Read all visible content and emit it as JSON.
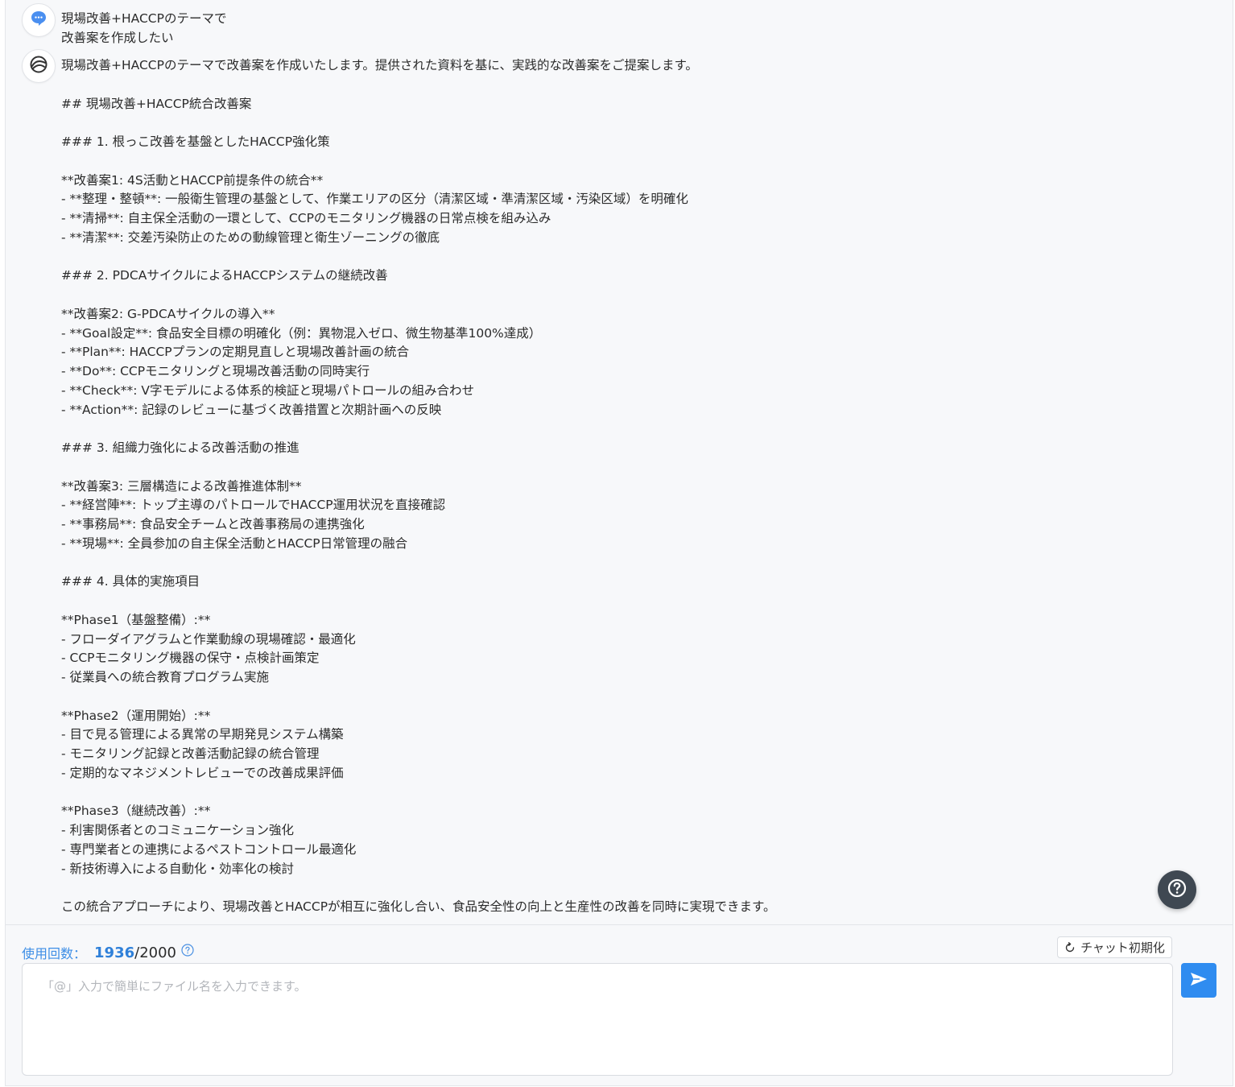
{
  "user_message": {
    "lines": [
      "現場改善+HACCPのテーマで",
      "改善案を作成したい"
    ]
  },
  "bot_message": {
    "lines": [
      "現場改善+HACCPのテーマで改善案を作成いたします。提供された資料を基に、実践的な改善案をご提案します。",
      "",
      "## 現場改善+HACCP統合改善案",
      "",
      "### 1. 根っこ改善を基盤としたHACCP強化策",
      "",
      "**改善案1: 4S活動とHACCP前提条件の統合**",
      "- **整理・整頓**: 一般衛生管理の基盤として、作業エリアの区分（清潔区域・準清潔区域・汚染区域）を明確化",
      "- **清掃**: 自主保全活動の一環として、CCPのモニタリング機器の日常点検を組み込み",
      "- **清潔**: 交差汚染防止のための動線管理と衛生ゾーニングの徹底",
      "",
      "### 2. PDCAサイクルによるHACCPシステムの継続改善",
      "",
      "**改善案2: G-PDCAサイクルの導入**",
      "- **Goal設定**: 食品安全目標の明確化（例：異物混入ゼロ、微生物基準100%達成）",
      "- **Plan**: HACCPプランの定期見直しと現場改善計画の統合",
      "- **Do**: CCPモニタリングと現場改善活動の同時実行",
      "- **Check**: V字モデルによる体系的検証と現場パトロールの組み合わせ",
      "- **Action**: 記録のレビューに基づく改善措置と次期計画への反映",
      "",
      "### 3. 組織力強化による改善活動の推進",
      "",
      "**改善案3: 三層構造による改善推進体制**",
      "- **経営陣**: トップ主導のパトロールでHACCP運用状況を直接確認",
      "- **事務局**: 食品安全チームと改善事務局の連携強化",
      "- **現場**: 全員参加の自主保全活動とHACCP日常管理の融合",
      "",
      "### 4. 具体的実施項目",
      "",
      "**Phase1（基盤整備）:**",
      "- フローダイアグラムと作業動線の現場確認・最適化",
      "- CCPモニタリング機器の保守・点検計画策定",
      "- 従業員への統合教育プログラム実施",
      "",
      "**Phase2（運用開始）:**",
      "- 目で見る管理による異常の早期発見システム構築",
      "- モニタリング記録と改善活動記録の統合管理",
      "- 定期的なマネジメントレビューでの改善成果評価",
      "",
      "**Phase3（継続改善）:**",
      "- 利害関係者とのコミュニケーション強化",
      "- 専門業者との連携によるペストコントロール最適化",
      "- 新技術導入による自動化・効率化の検討",
      "",
      "この統合アプローチにより、現場改善とHACCPが相互に強化し合い、食品安全性の向上と生産性の改善を同時に実現できます。"
    ]
  },
  "usage": {
    "label": "使用回数：",
    "count": "1936",
    "total": "/2000"
  },
  "reset_button": {
    "label": "チャット初期化"
  },
  "input": {
    "placeholder": "「@」入力で簡単にファイル名を入力できます。",
    "value": ""
  },
  "icons": {
    "user_avatar": "chat-bubble-icon",
    "bot_avatar": "bot-logo-icon",
    "help_fab": "question-icon",
    "usage_help": "question-circle-icon",
    "reset": "refresh-icon",
    "send": "send-icon"
  },
  "colors": {
    "accent": "#2f8cf0",
    "usage_label": "#3d8ee6",
    "fab": "#3f4852",
    "background": "#f7f8fa"
  }
}
